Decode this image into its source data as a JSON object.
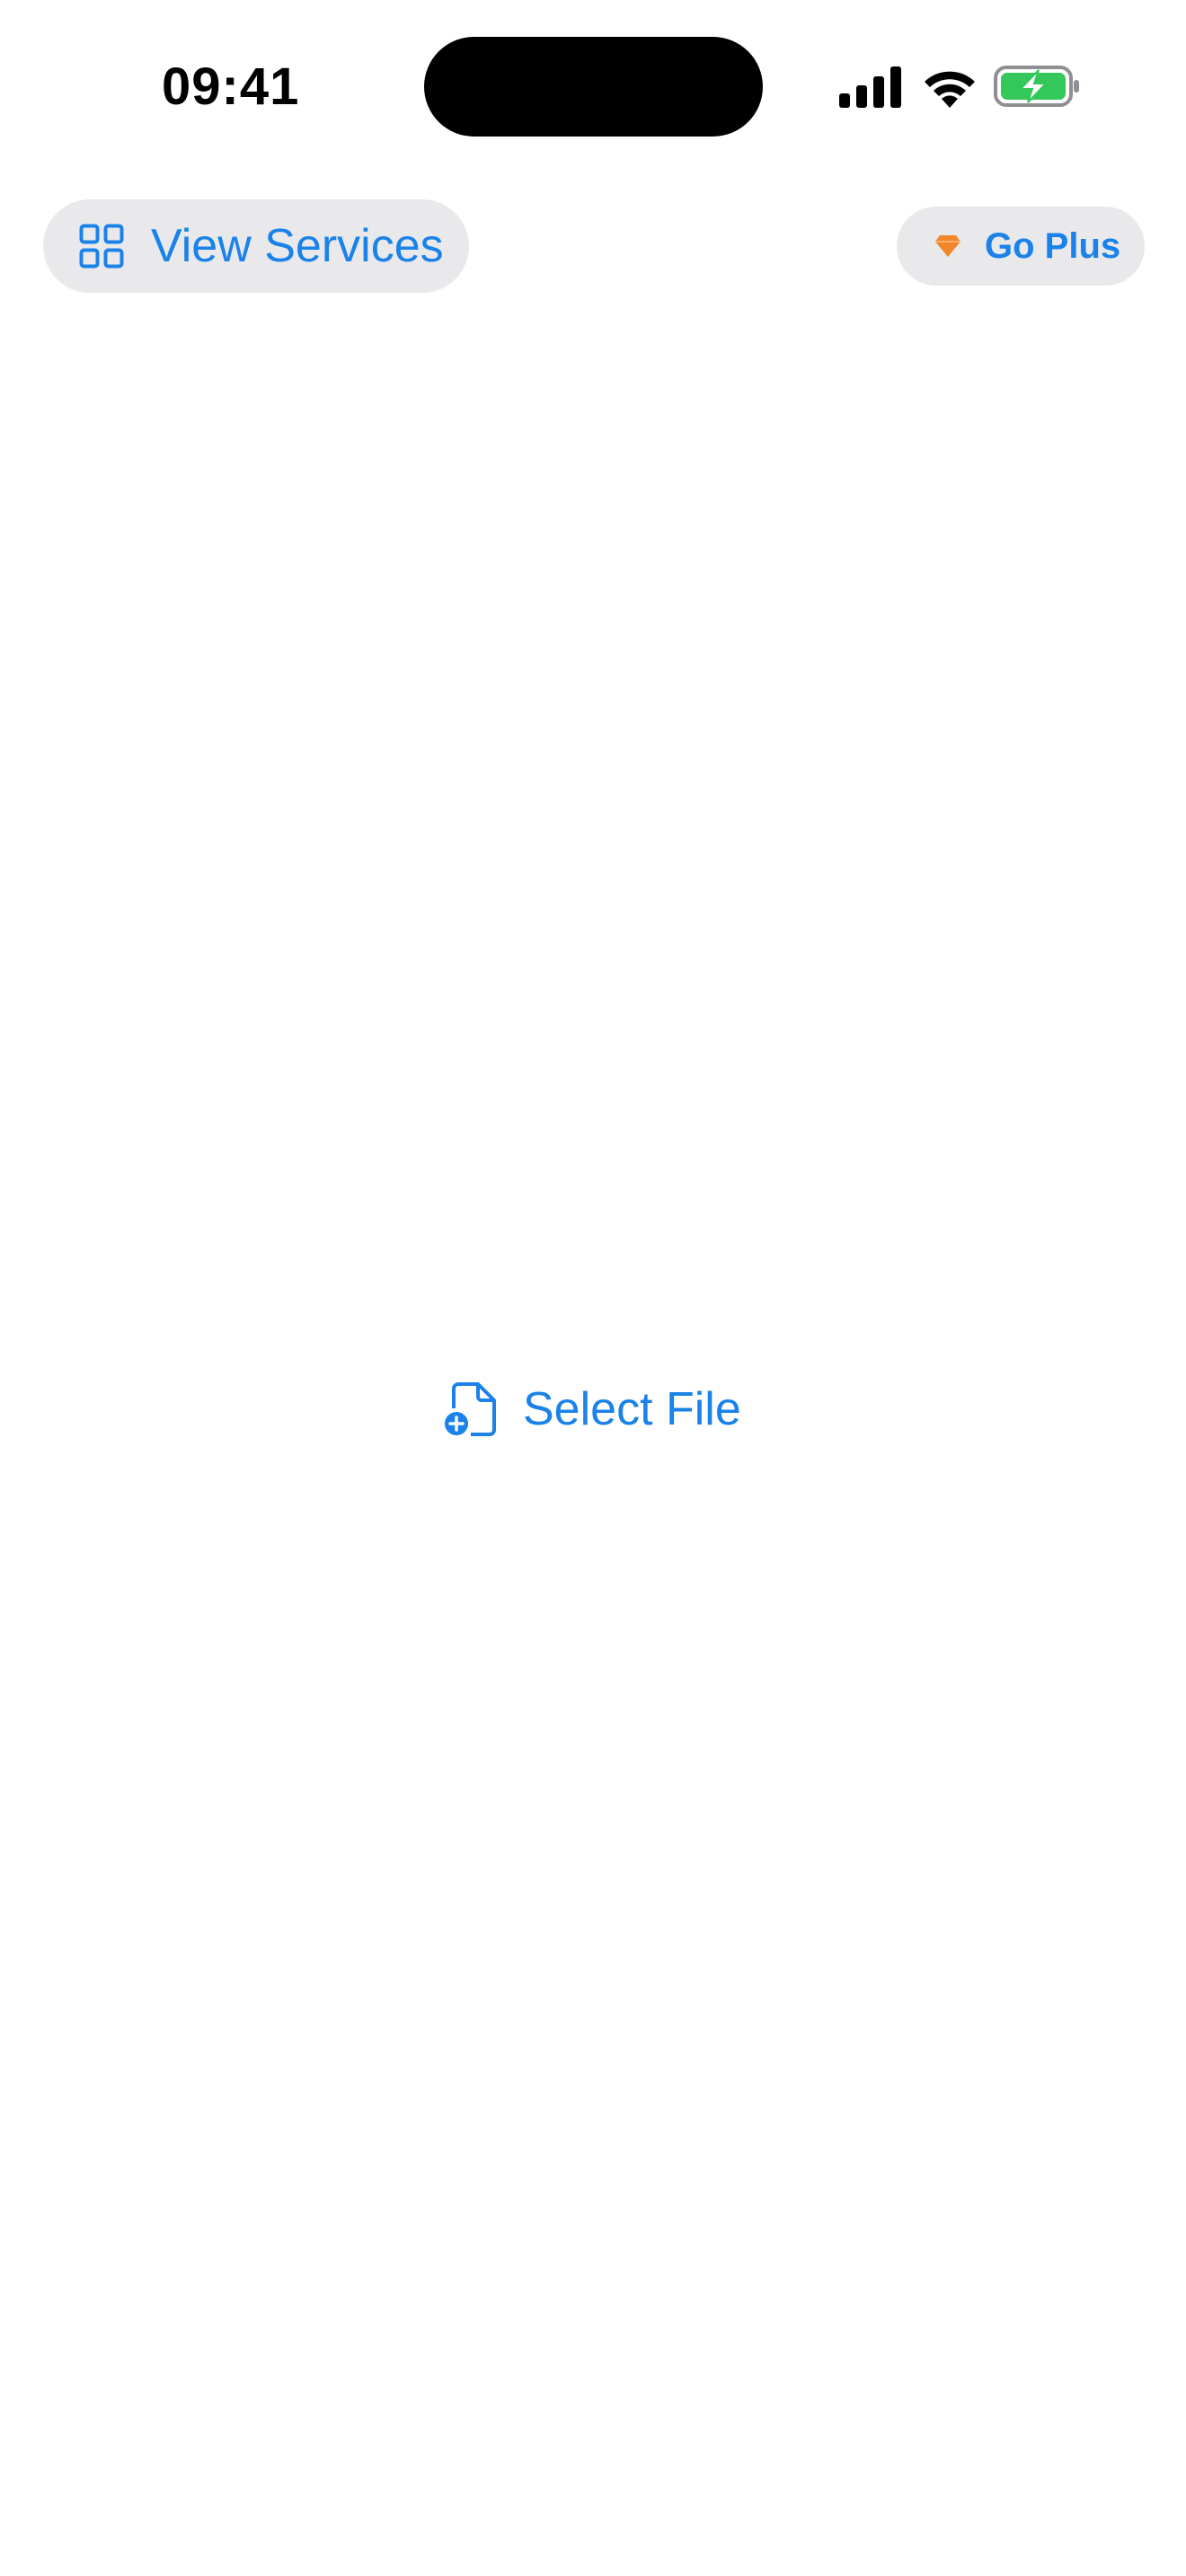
{
  "status_bar": {
    "time": "09:41",
    "icons": [
      "cellular-signal-icon",
      "wifi-icon",
      "battery-charging-icon"
    ]
  },
  "toolbar": {
    "view_services_label": "View Services",
    "view_services_icon": "grid-icon",
    "go_plus_label": "Go Plus",
    "go_plus_icon": "diamond-icon"
  },
  "main": {
    "select_file_label": "Select File",
    "select_file_icon": "document-add-icon"
  },
  "colors": {
    "accent": "#1a82e8",
    "button_background": "#e9e9eb",
    "premium": "#f2862a",
    "battery": "#34c759"
  }
}
